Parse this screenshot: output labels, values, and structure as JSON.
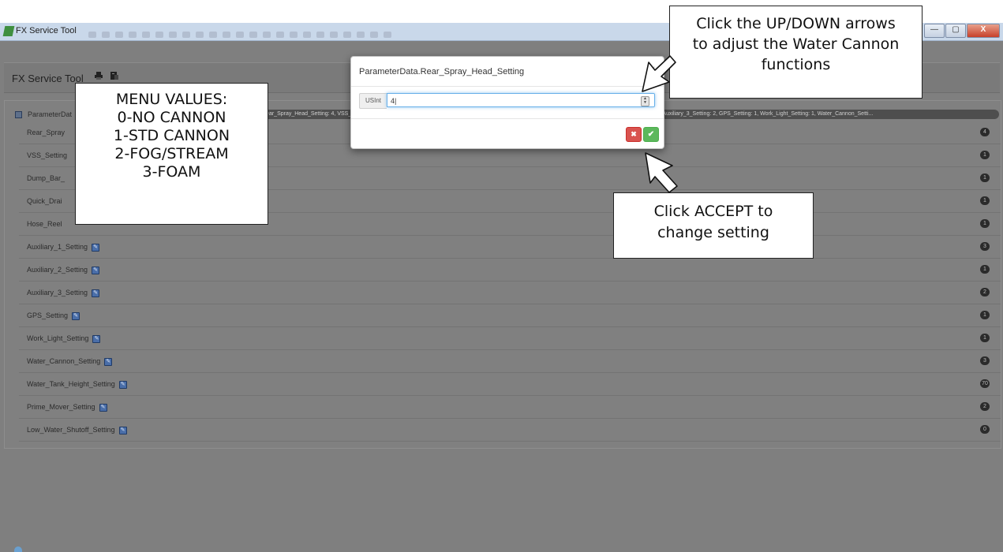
{
  "window": {
    "title": "FX Service Tool",
    "minimize": "—",
    "maximize": "▢",
    "close": "X"
  },
  "app": {
    "title": "FX Service Tool",
    "print_icon": "printer-icon",
    "export_icon": "export-icon"
  },
  "tree": {
    "root_label": "ParameterDat",
    "root_summary": "Rear_Spray_Head_Setting: 4, VSS_Setting: 1, Dump_Bar_Setting: 1, Quick_Drain_Setting: 1, Hose_Reel_Setting: 1, Auxiliary_1_Setting: 3, Auxiliary_2_Setting: 1, Auxiliary_3_Setting: 2, GPS_Setting: 1, Work_Light_Setting: 1, Water_Cannon_Setti...",
    "items": [
      {
        "label": "Rear_Spray",
        "value": "4"
      },
      {
        "label": "VSS_Setting",
        "value": "1"
      },
      {
        "label": "Dump_Bar_",
        "value": "1"
      },
      {
        "label": "Quick_Drai",
        "value": "1"
      },
      {
        "label": "Hose_Reel",
        "value": "1"
      },
      {
        "label": "Auxiliary_1_Setting",
        "value": "3"
      },
      {
        "label": "Auxiliary_2_Setting",
        "value": "1"
      },
      {
        "label": "Auxiliary_3_Setting",
        "value": "2"
      },
      {
        "label": "GPS_Setting",
        "value": "1"
      },
      {
        "label": "Work_Light_Setting",
        "value": "1"
      },
      {
        "label": "Water_Cannon_Setting",
        "value": "3"
      },
      {
        "label": "Water_Tank_Height_Setting",
        "value": "70"
      },
      {
        "label": "Prime_Mover_Setting",
        "value": "2"
      },
      {
        "label": "Low_Water_Shutoff_Setting",
        "value": "0"
      }
    ]
  },
  "modal": {
    "title": "ParameterData.Rear_Spray_Head_Setting",
    "close": "×",
    "type_label": "USInt",
    "value": "4",
    "cancel_icon": "✖",
    "accept_icon": "✔"
  },
  "callouts": {
    "menu": [
      "MENU VALUES:",
      "0-NO CANNON",
      "1-STD CANNON",
      "2-FOG/STREAM",
      "3-FOAM"
    ],
    "arrows": [
      "Click the UP/DOWN arrows",
      "to adjust the Water Cannon",
      "functions"
    ],
    "accept": [
      "Click ACCEPT to",
      "change setting"
    ]
  },
  "colors": {
    "cancel": "#d9534f",
    "accept": "#5cb85c",
    "focus": "#66afe9"
  }
}
